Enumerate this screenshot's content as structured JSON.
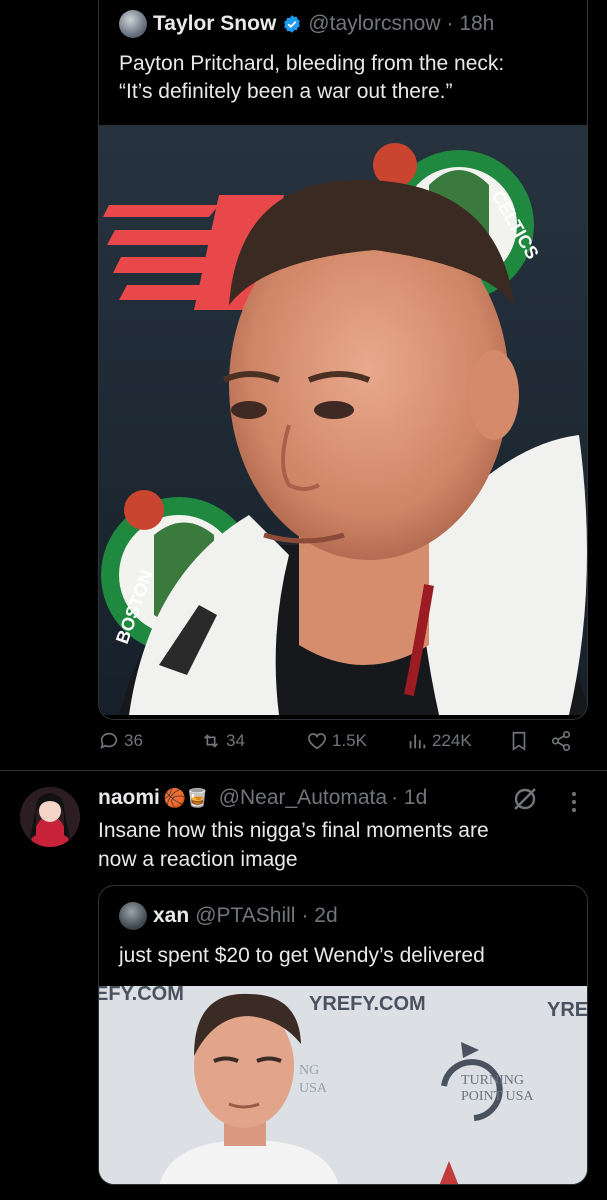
{
  "quoted_tweet": {
    "author_name": "Taylor Snow",
    "handle": "@taylorcsnow",
    "time": "· 18h",
    "text_line1": "Payton Pritchard, bleeding from the neck:",
    "text_line2": "“It’s definitely been a war out there.”",
    "image": {
      "description_icon": "photo-icon",
      "backdrop_text_top": "CELTICS",
      "backdrop_text_bottom": "BOSTON"
    },
    "actions": {
      "replies": "36",
      "reposts": "34",
      "likes": "1.5K",
      "views": "224K"
    }
  },
  "reply": {
    "author_name": "naomi",
    "author_emoji": "🏀🥃",
    "handle": "@Near_Automata",
    "time": "· 1d",
    "text_line1": "Insane how this nigga’s final moments are",
    "text_line2": "now a reaction image",
    "inner_quote": {
      "author_name": "xan",
      "handle": "@PTAShill",
      "time": "· 2d",
      "text": "just spent $20 to get Wendy’s delivered",
      "backdrop_text_left": "EFY.COM",
      "backdrop_text_mid": "YREFY.COM",
      "backdrop_text_right": "YRE",
      "backdrop_text_ng": "NG",
      "backdrop_text_usa": "USA",
      "logo_line1": "TURNING",
      "logo_line2": "POINT USA"
    }
  },
  "colors": {
    "background": "#000000",
    "text": "#e7e9ea",
    "muted": "#71767b",
    "border": "#2f3336",
    "verified": "#1d9bf0"
  }
}
